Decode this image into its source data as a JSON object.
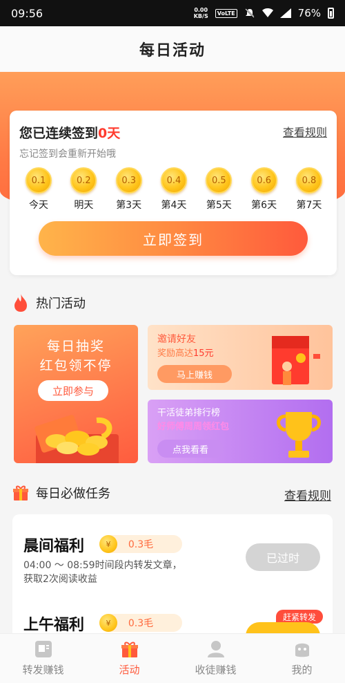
{
  "status_bar": {
    "time": "09:56",
    "net_speed": "0.00",
    "net_unit": "KB/S",
    "volte": "VoLTE",
    "battery": "76%"
  },
  "header": {
    "title": "每日活动"
  },
  "signin": {
    "title_prefix": "您已连续签到",
    "days": "0天",
    "rule_link": "查看规则",
    "hint": "忘记签到会重新开始哦",
    "coins": [
      {
        "value": "0.1",
        "label": "今天"
      },
      {
        "value": "0.2",
        "label": "明天"
      },
      {
        "value": "0.3",
        "label": "第3天"
      },
      {
        "value": "0.4",
        "label": "第4天"
      },
      {
        "value": "0.5",
        "label": "第5天"
      },
      {
        "value": "0.6",
        "label": "第6天"
      },
      {
        "value": "0.8",
        "label": "第7天"
      }
    ],
    "button": "立即签到"
  },
  "hot": {
    "title": "热门活动",
    "lottery": {
      "line1": "每日抽奖",
      "line2": "红包领不停",
      "button": "立即参与"
    },
    "invite": {
      "title": "邀请好友",
      "reward_prefix": "奖励高达",
      "reward_amount": "15元",
      "button": "马上赚钱"
    },
    "rank": {
      "title": "干活徒弟排行榜",
      "subtitle": "好师傅周周领红包",
      "button": "点我看看"
    }
  },
  "daily": {
    "title": "每日必做任务",
    "rule_link": "查看规则",
    "tasks": [
      {
        "name": "晨间福利",
        "reward": "0.3毛",
        "coin_symbol": "¥",
        "desc": "04:00 ～ 08:59时间段内转发文章，获取2次阅读收益",
        "status": "已过时"
      },
      {
        "name": "上午福利",
        "reward": "0.3毛",
        "coin_symbol": "¥",
        "tag": "赶紧转发"
      }
    ]
  },
  "tabbar": {
    "items": [
      {
        "label": "转发赚钱",
        "icon": "share-doc-icon"
      },
      {
        "label": "活动",
        "icon": "gift-icon"
      },
      {
        "label": "收徒赚钱",
        "icon": "user-icon"
      },
      {
        "label": "我的",
        "icon": "face-icon"
      }
    ],
    "active_color": "#ff5a3c"
  }
}
